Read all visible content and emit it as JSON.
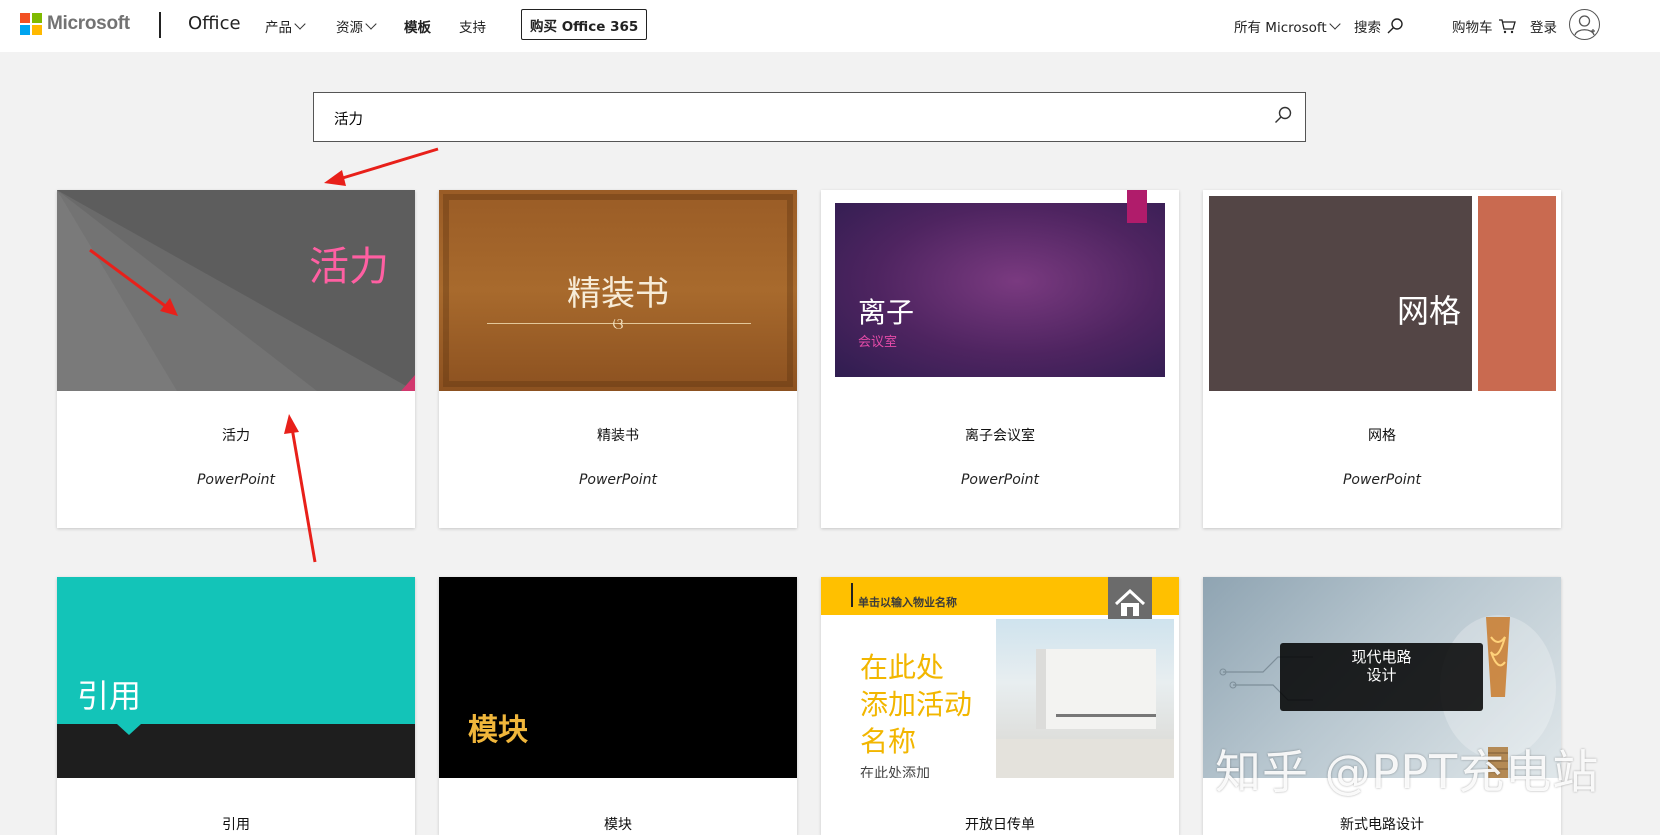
{
  "header": {
    "brand": "Microsoft",
    "product": "Office",
    "nav": [
      "产品",
      "资源",
      "模板",
      "支持"
    ],
    "buy_button": "购买 Office 365",
    "all_microsoft": "所有 Microsoft",
    "search": "搜索",
    "cart": "购物车",
    "login": "登录"
  },
  "search": {
    "value": "活力"
  },
  "cards": [
    {
      "title": "活力",
      "app": "PowerPoint",
      "thumb_text": "活力"
    },
    {
      "title": "精装书",
      "app": "PowerPoint",
      "thumb_text": "精装书",
      "thumb_ornament": "ଓ"
    },
    {
      "title": "离子会议室",
      "app": "PowerPoint",
      "thumb_text": "离子",
      "thumb_sub": "会议室"
    },
    {
      "title": "网格",
      "app": "PowerPoint",
      "thumb_text": "网格"
    },
    {
      "title": "引用",
      "thumb_text": "引用"
    },
    {
      "title": "模块",
      "thumb_text": "模块"
    },
    {
      "title": "开放日传单",
      "thumb_header": "单击以输入物业名称",
      "thumb_lines": [
        "在此处",
        "添加活动",
        "名称"
      ],
      "thumb_small": "在此处添加"
    },
    {
      "title": "新式电路设计",
      "thumb_lines": [
        "现代电路",
        "设计"
      ]
    }
  ],
  "watermark": "知乎 @PPT充电站",
  "colors": {
    "arrow": "#e8201a",
    "pink": "#ff5fa2",
    "ion_purple": "#5a2a63",
    "grid_brown": "#534545",
    "grid_orange": "#c96a50",
    "teal": "#13c4b8",
    "flyer_yellow": "#ffc000"
  }
}
